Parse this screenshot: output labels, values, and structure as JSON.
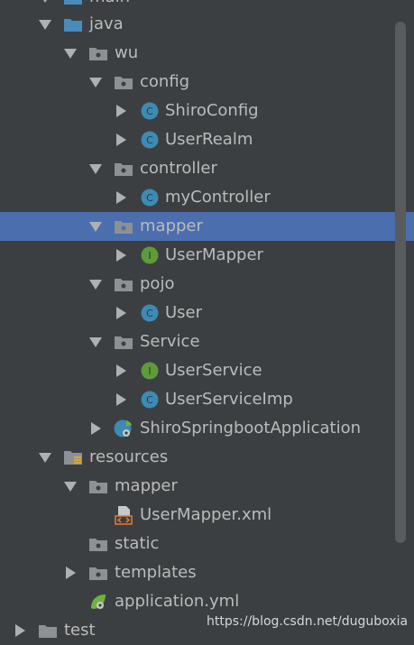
{
  "tree": {
    "nodes": [
      {
        "label": "main",
        "type": "source-folder",
        "state": "expanded"
      },
      {
        "label": "java",
        "type": "source-folder",
        "state": "expanded"
      },
      {
        "label": "wu",
        "type": "package",
        "state": "expanded"
      },
      {
        "label": "config",
        "type": "package",
        "state": "expanded"
      },
      {
        "label": "ShiroConfig",
        "type": "class",
        "state": "collapsed"
      },
      {
        "label": "UserRealm",
        "type": "class",
        "state": "collapsed"
      },
      {
        "label": "controller",
        "type": "package",
        "state": "expanded"
      },
      {
        "label": "myController",
        "type": "class",
        "state": "collapsed"
      },
      {
        "label": "mapper",
        "type": "package",
        "state": "expanded",
        "selected": true
      },
      {
        "label": "UserMapper",
        "type": "interface",
        "state": "collapsed"
      },
      {
        "label": "pojo",
        "type": "package",
        "state": "expanded"
      },
      {
        "label": "User",
        "type": "class",
        "state": "collapsed"
      },
      {
        "label": "Service",
        "type": "package",
        "state": "expanded"
      },
      {
        "label": "UserService",
        "type": "interface",
        "state": "collapsed"
      },
      {
        "label": "UserServiceImp",
        "type": "class",
        "state": "collapsed"
      },
      {
        "label": "ShiroSpringbootApplication",
        "type": "spring-class",
        "state": "collapsed"
      },
      {
        "label": "resources",
        "type": "resources-folder",
        "state": "expanded"
      },
      {
        "label": "mapper",
        "type": "package",
        "state": "expanded"
      },
      {
        "label": "UserMapper.xml",
        "type": "xml-file",
        "state": "leaf"
      },
      {
        "label": "static",
        "type": "package",
        "state": "leaf"
      },
      {
        "label": "templates",
        "type": "package",
        "state": "collapsed"
      },
      {
        "label": "application.yml",
        "type": "yml-file",
        "state": "leaf"
      },
      {
        "label": "test",
        "type": "folder",
        "state": "collapsed"
      }
    ],
    "class_badge": "C",
    "interface_badge": "I"
  },
  "watermark": "https://blog.csdn.net/duguboxia",
  "colors": {
    "background": "#3c3f41",
    "selection": "#4b6eaf",
    "text": "#bbbbbb",
    "class_icon": "#3d8ab3",
    "interface_icon": "#5e9b3a",
    "folder": "#8e9194",
    "source_folder": "#4a8bbd"
  }
}
